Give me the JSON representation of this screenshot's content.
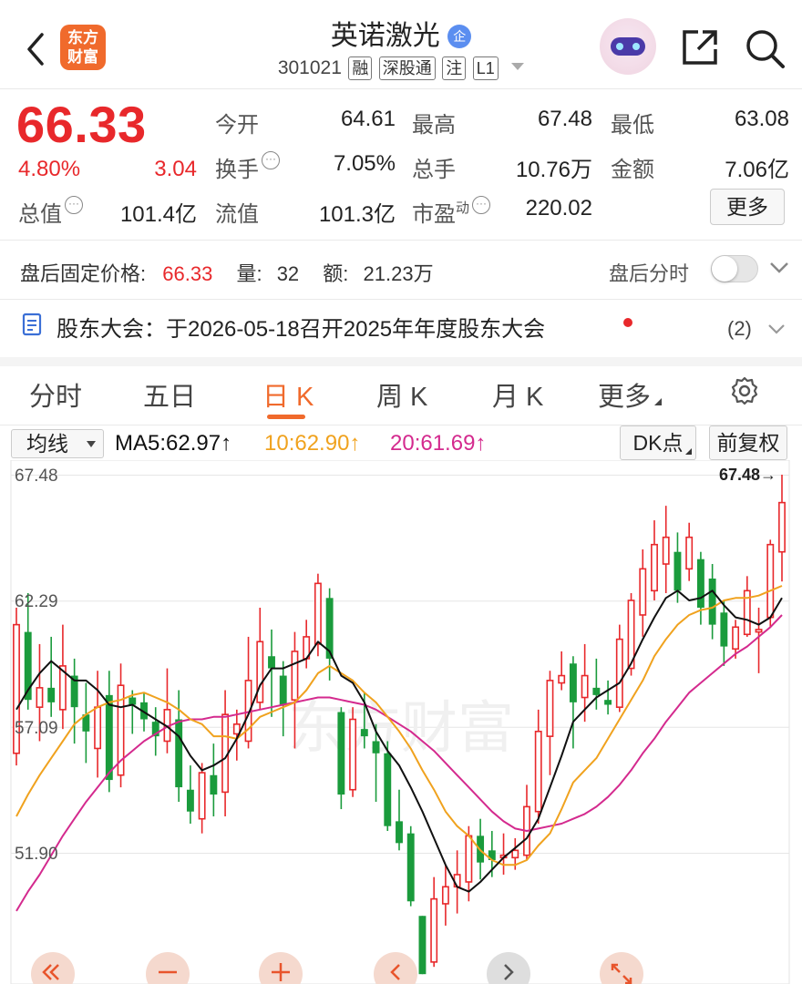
{
  "header": {
    "title": "英诺激光",
    "title_badge": "企",
    "code": "301021",
    "tags": [
      "融",
      "深股通",
      "注",
      "L1"
    ],
    "logo_line1": "东方",
    "logo_line2": "财富"
  },
  "quote": {
    "price": "66.33",
    "change_pct": "4.80%",
    "change": "3.04",
    "rows": [
      [
        {
          "label": "今开",
          "value": "64.61",
          "color": "red"
        },
        {
          "label": "最高",
          "value": "67.48",
          "color": "red"
        },
        {
          "label": "最低",
          "value": "63.08",
          "color": "green"
        }
      ],
      [
        {
          "label": "换手",
          "value": "7.05%",
          "color": "black"
        },
        {
          "label": "总手",
          "value": "10.76万",
          "color": "black"
        },
        {
          "label": "金额",
          "value": "7.06亿",
          "color": "black"
        }
      ],
      [
        {
          "label": "流值",
          "value": "101.3亿",
          "color": "black"
        },
        {
          "label": "市盈",
          "sup": "动",
          "value": "220.02",
          "color": "black"
        }
      ]
    ],
    "total_value_label": "总值",
    "total_value": "101.4亿",
    "more_button": "更多"
  },
  "after_hours": {
    "label": "盘后固定价格:",
    "price": "66.33",
    "vol_label": "量:",
    "vol": "32",
    "amt_label": "额:",
    "amt": "21.23万",
    "toggle_label": "盘后分时",
    "toggle_on": false
  },
  "notice": {
    "text": "股东大会：于2026-05-18召开2025年年度股东大会",
    "count": "(2)"
  },
  "tabs": [
    "分时",
    "五日",
    "日 K",
    "周 K",
    "月 K",
    "更多"
  ],
  "active_tab": 2,
  "indicators": {
    "select_label": "均线",
    "ma5": "MA5:62.97",
    "ma10": "10:62.90",
    "ma20": "20:61.69",
    "arrow": "↑",
    "dk_button": "DK点",
    "fq_button": "前复权"
  },
  "colors": {
    "up": "#e8282b",
    "down": "#1a9b3c",
    "ma5": "#111111",
    "ma10": "#f0a21e",
    "ma20": "#d42a8e",
    "accent": "#f06a2c"
  },
  "chart_data": {
    "type": "candlestick",
    "y_ticks": [
      "67.48",
      "62.29",
      "57.09",
      "51.90"
    ],
    "ylim": [
      46.9,
      67.9
    ],
    "max_label": "67.48→",
    "watermark": "东方财富",
    "candles": [
      {
        "o": 56.0,
        "c": 61.3,
        "h": 62.0,
        "l": 55.5
      },
      {
        "o": 61.0,
        "c": 58.2,
        "h": 62.6,
        "l": 57.8
      },
      {
        "o": 57.9,
        "c": 58.7,
        "h": 60.5,
        "l": 56.5
      },
      {
        "o": 58.7,
        "c": 58.1,
        "h": 60.8,
        "l": 57.5
      },
      {
        "o": 57.8,
        "c": 59.6,
        "h": 61.3,
        "l": 57.0
      },
      {
        "o": 59.2,
        "c": 57.9,
        "h": 59.9,
        "l": 56.4
      },
      {
        "o": 57.6,
        "c": 56.9,
        "h": 58.9,
        "l": 55.6
      },
      {
        "o": 56.2,
        "c": 57.9,
        "h": 59.4,
        "l": 55.0
      },
      {
        "o": 58.4,
        "c": 54.9,
        "h": 59.4,
        "l": 54.4
      },
      {
        "o": 55.1,
        "c": 58.8,
        "h": 59.7,
        "l": 54.6
      },
      {
        "o": 58.3,
        "c": 58.0,
        "h": 58.6,
        "l": 56.8
      },
      {
        "o": 58.1,
        "c": 57.4,
        "h": 58.5,
        "l": 56.9
      },
      {
        "o": 57.3,
        "c": 56.7,
        "h": 57.9,
        "l": 55.9
      },
      {
        "o": 56.5,
        "c": 57.8,
        "h": 59.5,
        "l": 56.0
      },
      {
        "o": 57.4,
        "c": 54.6,
        "h": 58.6,
        "l": 54.0
      },
      {
        "o": 54.5,
        "c": 53.6,
        "h": 55.5,
        "l": 53.1
      },
      {
        "o": 53.3,
        "c": 55.2,
        "h": 55.6,
        "l": 52.7
      },
      {
        "o": 55.1,
        "c": 54.3,
        "h": 56.4,
        "l": 53.4
      },
      {
        "o": 54.4,
        "c": 57.6,
        "h": 58.6,
        "l": 53.4
      },
      {
        "o": 56.8,
        "c": 57.2,
        "h": 57.8,
        "l": 55.7
      },
      {
        "o": 56.5,
        "c": 59.0,
        "h": 60.8,
        "l": 56.2
      },
      {
        "o": 58.1,
        "c": 60.6,
        "h": 62.0,
        "l": 57.8
      },
      {
        "o": 60.0,
        "c": 59.5,
        "h": 61.1,
        "l": 57.5
      },
      {
        "o": 59.2,
        "c": 58.0,
        "h": 59.8,
        "l": 56.7
      },
      {
        "o": 58.2,
        "c": 60.2,
        "h": 61.0,
        "l": 56.2
      },
      {
        "o": 59.9,
        "c": 60.8,
        "h": 61.5,
        "l": 59.5
      },
      {
        "o": 60.5,
        "c": 63.0,
        "h": 63.4,
        "l": 60.0
      },
      {
        "o": 62.4,
        "c": 59.9,
        "h": 62.8,
        "l": 59.0
      },
      {
        "o": 57.7,
        "c": 54.3,
        "h": 57.9,
        "l": 53.7
      },
      {
        "o": 54.5,
        "c": 57.4,
        "h": 57.9,
        "l": 54.2
      },
      {
        "o": 57.0,
        "c": 56.7,
        "h": 58.5,
        "l": 56.2
      },
      {
        "o": 56.5,
        "c": 56.0,
        "h": 57.2,
        "l": 54.0
      },
      {
        "o": 56.0,
        "c": 53.0,
        "h": 56.5,
        "l": 52.8
      },
      {
        "o": 53.2,
        "c": 52.3,
        "h": 54.5,
        "l": 52.0
      },
      {
        "o": 52.7,
        "c": 49.9,
        "h": 53.0,
        "l": 49.7
      },
      {
        "o": 49.3,
        "c": 46.9,
        "h": 49.3,
        "l": 46.9
      },
      {
        "o": 47.4,
        "c": 50.0,
        "h": 50.9,
        "l": 47.2
      },
      {
        "o": 49.8,
        "c": 50.5,
        "h": 51.4,
        "l": 48.9
      },
      {
        "o": 50.5,
        "c": 51.0,
        "h": 52.0,
        "l": 49.4
      },
      {
        "o": 50.7,
        "c": 52.6,
        "h": 53.0,
        "l": 49.9
      },
      {
        "o": 52.6,
        "c": 51.5,
        "h": 53.3,
        "l": 50.8
      },
      {
        "o": 52.0,
        "c": 51.6,
        "h": 52.8,
        "l": 50.9
      },
      {
        "o": 51.7,
        "c": 51.8,
        "h": 52.7,
        "l": 51.0
      },
      {
        "o": 51.7,
        "c": 52.0,
        "h": 52.5,
        "l": 51.2
      },
      {
        "o": 51.8,
        "c": 53.8,
        "h": 54.7,
        "l": 51.6
      },
      {
        "o": 53.6,
        "c": 56.9,
        "h": 57.8,
        "l": 53.1
      },
      {
        "o": 56.7,
        "c": 59.0,
        "h": 59.4,
        "l": 55.1
      },
      {
        "o": 58.9,
        "c": 59.2,
        "h": 60.2,
        "l": 58.6
      },
      {
        "o": 59.7,
        "c": 58.1,
        "h": 60.0,
        "l": 56.2
      },
      {
        "o": 58.3,
        "c": 59.2,
        "h": 60.5,
        "l": 57.3
      },
      {
        "o": 58.7,
        "c": 58.4,
        "h": 59.9,
        "l": 57.8
      },
      {
        "o": 58.2,
        "c": 58.0,
        "h": 59.0,
        "l": 57.6
      },
      {
        "o": 57.9,
        "c": 60.7,
        "h": 61.3,
        "l": 57.7
      },
      {
        "o": 59.5,
        "c": 62.3,
        "h": 62.6,
        "l": 59.2
      },
      {
        "o": 61.7,
        "c": 63.6,
        "h": 64.4,
        "l": 60.8
      },
      {
        "o": 62.7,
        "c": 64.6,
        "h": 65.6,
        "l": 62.3
      },
      {
        "o": 63.8,
        "c": 64.9,
        "h": 66.2,
        "l": 62.6
      },
      {
        "o": 64.3,
        "c": 62.7,
        "h": 65.1,
        "l": 62.2
      },
      {
        "o": 63.6,
        "c": 64.9,
        "h": 65.5,
        "l": 63.1
      },
      {
        "o": 64.0,
        "c": 62.0,
        "h": 64.3,
        "l": 61.3
      },
      {
        "o": 63.2,
        "c": 61.3,
        "h": 63.8,
        "l": 60.7
      },
      {
        "o": 61.8,
        "c": 60.4,
        "h": 62.3,
        "l": 59.6
      },
      {
        "o": 60.3,
        "c": 61.2,
        "h": 61.5,
        "l": 59.9
      },
      {
        "o": 60.9,
        "c": 62.7,
        "h": 63.3,
        "l": 60.8
      },
      {
        "o": 61.0,
        "c": 61.1,
        "h": 62.0,
        "l": 59.3
      },
      {
        "o": 61.6,
        "c": 64.6,
        "h": 64.8,
        "l": 61.2
      },
      {
        "o": 64.3,
        "c": 66.33,
        "h": 67.48,
        "l": 63.08
      }
    ],
    "ma5": [
      57.8,
      58.6,
      59.3,
      59.8,
      59.4,
      59.0,
      59.0,
      58.6,
      58.0,
      57.9,
      58.0,
      57.7,
      57.4,
      57.1,
      56.7,
      55.9,
      55.3,
      55.5,
      55.8,
      56.6,
      57.6,
      58.8,
      59.5,
      59.5,
      59.7,
      59.9,
      60.6,
      60.2,
      59.2,
      58.9,
      58.1,
      56.9,
      56.1,
      55.5,
      54.6,
      53.6,
      52.5,
      51.4,
      50.5,
      50.3,
      50.7,
      51.2,
      51.7,
      52.1,
      52.5,
      53.3,
      54.6,
      55.9,
      57.3,
      57.8,
      58.3,
      58.6,
      58.9,
      59.7,
      60.7,
      61.6,
      62.4,
      62.7,
      62.3,
      62.4,
      62.7,
      62.1,
      61.6,
      61.5,
      61.3,
      61.6,
      62.4
    ],
    "ma10": [
      53.4,
      54.3,
      55.1,
      55.8,
      56.5,
      57.2,
      57.6,
      57.9,
      58.1,
      58.2,
      58.4,
      58.5,
      58.3,
      58.1,
      57.8,
      57.4,
      57.2,
      56.7,
      56.7,
      56.6,
      57.0,
      57.5,
      57.7,
      57.9,
      58.1,
      58.6,
      59.3,
      59.6,
      59.3,
      59.0,
      58.5,
      58.1,
      57.5,
      56.9,
      56.2,
      55.3,
      54.5,
      53.6,
      53.0,
      52.6,
      52.0,
      51.6,
      51.4,
      51.4,
      51.6,
      52.2,
      52.7,
      53.7,
      54.8,
      55.3,
      55.8,
      56.6,
      57.4,
      58.2,
      59.0,
      60.0,
      60.7,
      61.3,
      61.7,
      61.9,
      62.0,
      62.3,
      62.4,
      62.4,
      62.5,
      62.7,
      62.9
    ],
    "ma20": [
      49.5,
      50.3,
      51.0,
      51.8,
      52.6,
      53.3,
      54.0,
      54.6,
      55.2,
      55.7,
      56.1,
      56.5,
      56.8,
      57.1,
      57.3,
      57.4,
      57.4,
      57.5,
      57.5,
      57.6,
      57.7,
      57.8,
      57.9,
      58.0,
      58.1,
      58.2,
      58.3,
      58.3,
      58.2,
      58.1,
      58.0,
      57.8,
      57.5,
      57.2,
      56.9,
      56.5,
      56.1,
      55.6,
      55.1,
      54.6,
      54.1,
      53.6,
      53.2,
      52.9,
      52.8,
      52.9,
      53.0,
      53.1,
      53.3,
      53.5,
      53.8,
      54.2,
      54.7,
      55.3,
      56.0,
      56.6,
      57.3,
      57.9,
      58.5,
      58.9,
      59.3,
      59.7,
      60.1,
      60.4,
      60.8,
      61.2,
      61.7
    ]
  },
  "bottom_controls": [
    "double-left",
    "zoom-out",
    "zoom-in",
    "prev",
    "next",
    "expand"
  ]
}
